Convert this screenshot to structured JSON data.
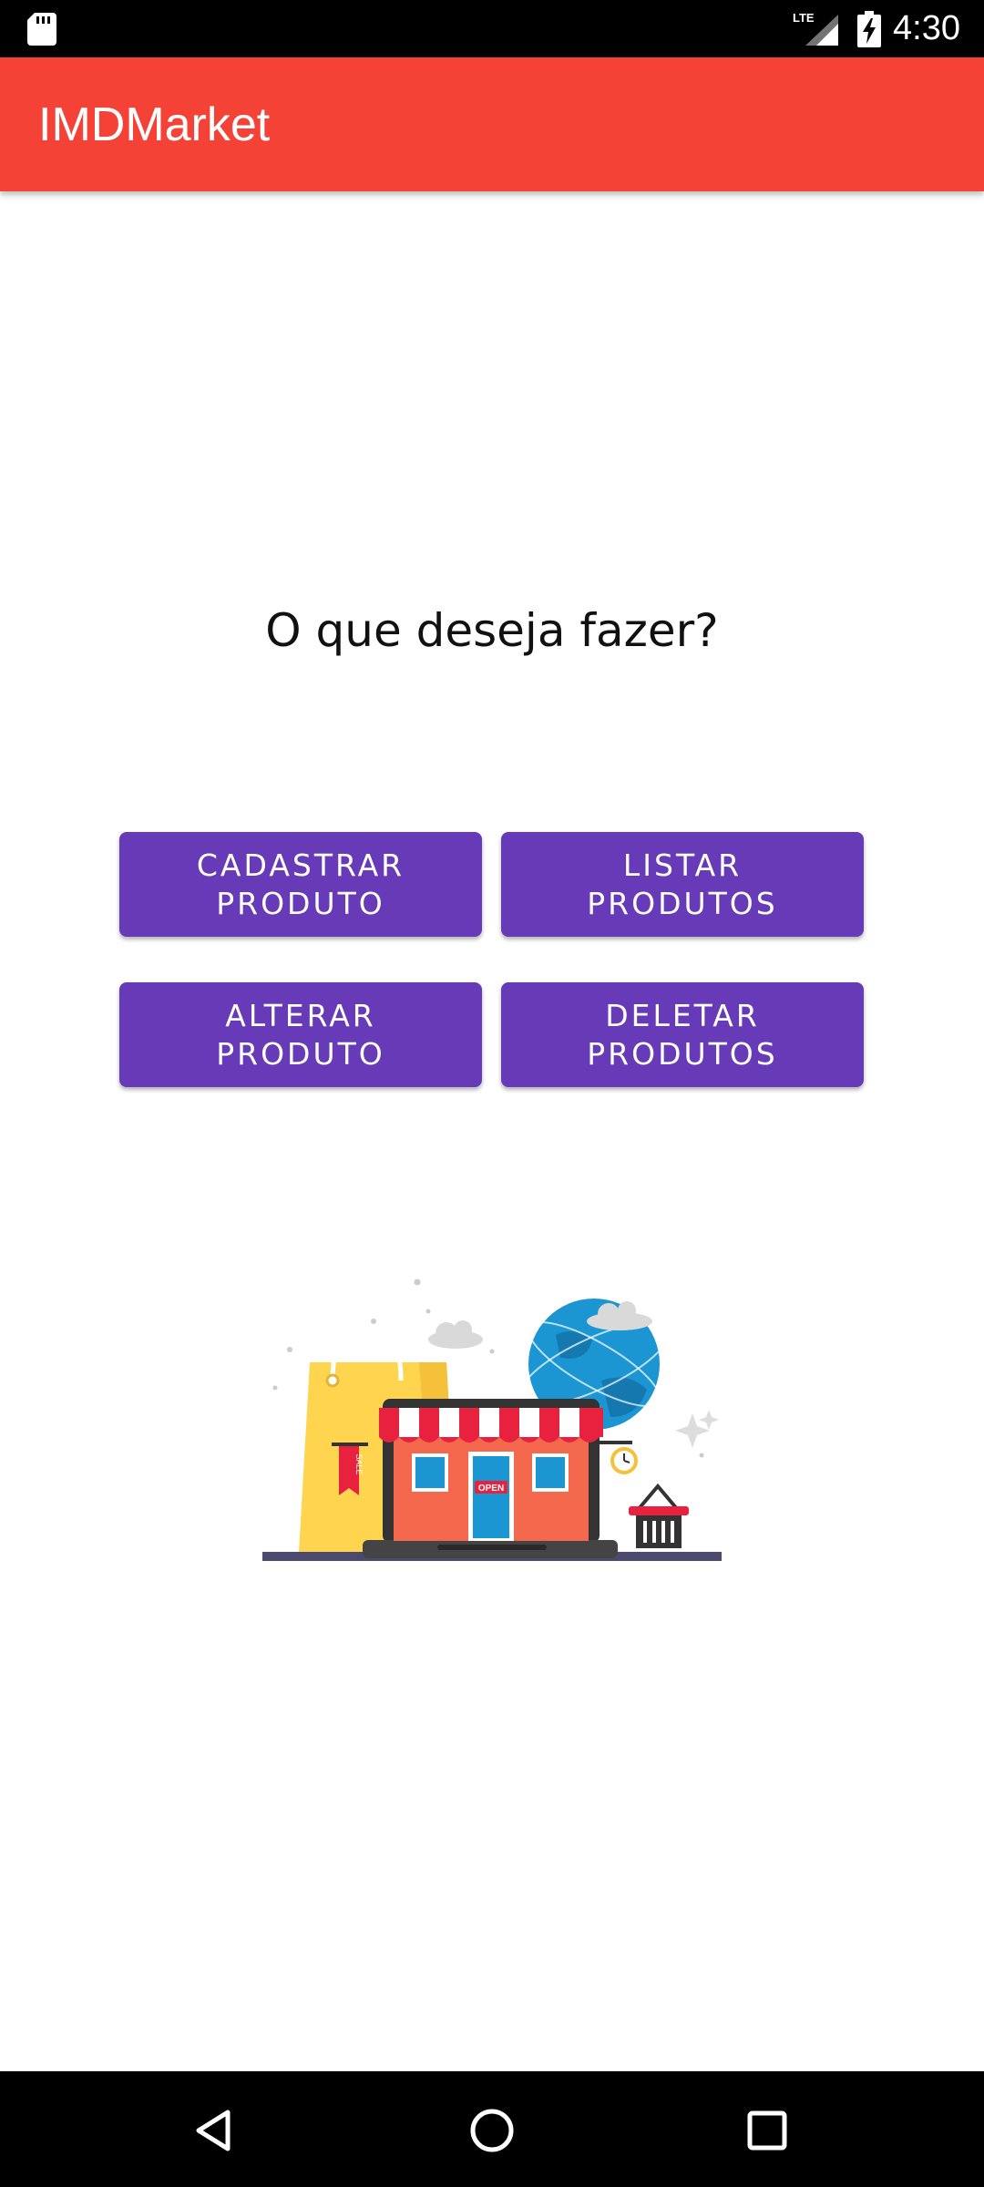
{
  "status_bar": {
    "time": "4:30",
    "network": "LTE",
    "icons": [
      "sd-card-icon",
      "lte-signal-icon",
      "battery-charging-icon"
    ]
  },
  "app_bar": {
    "title": "IMDMarket",
    "color": "#f44336"
  },
  "main": {
    "prompt": "O que deseja fazer?",
    "buttons": [
      {
        "label": "CADASTRAR\nPRODUTO"
      },
      {
        "label": "LISTAR\nPRODUTOS"
      },
      {
        "label": "ALTERAR\nPRODUTO"
      },
      {
        "label": "DELETAR\nPRODUTOS"
      }
    ],
    "button_color": "#673ab7",
    "illustration": {
      "icon": "online-store-illustration-icon",
      "sign_text": "OPEN",
      "tag_text": "SALE"
    }
  },
  "nav_bar": {
    "icons": [
      "back-icon",
      "home-icon",
      "recents-icon"
    ]
  }
}
